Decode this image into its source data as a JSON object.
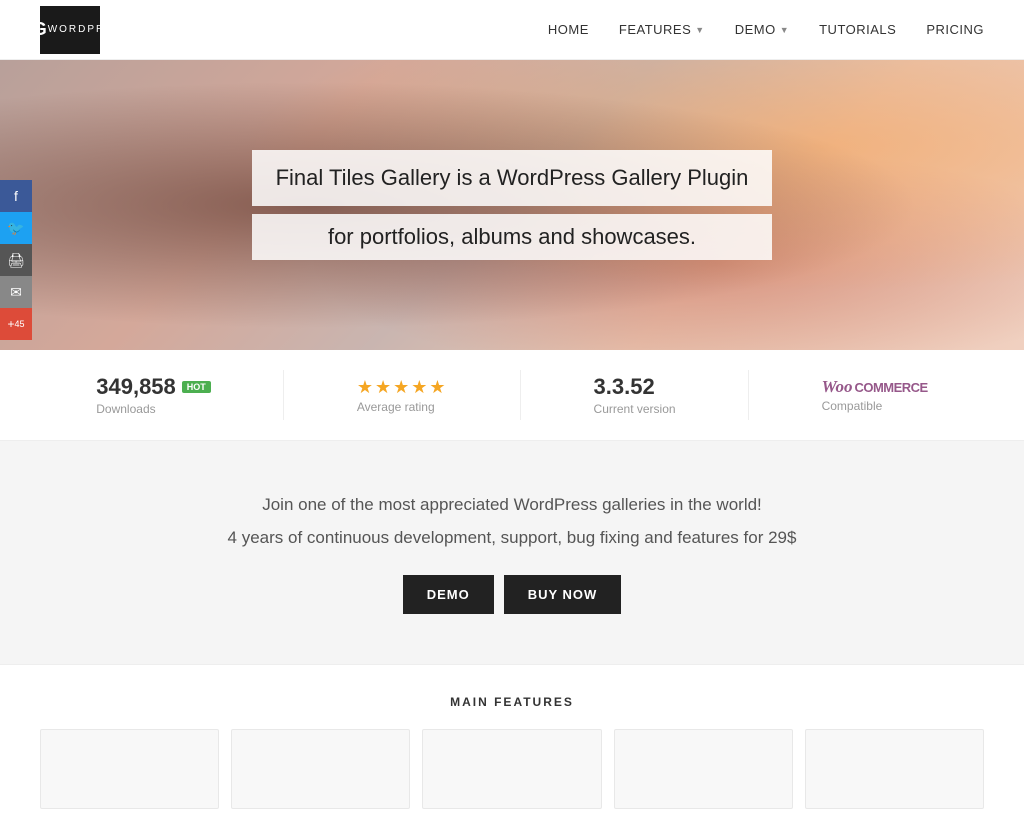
{
  "logo": {
    "main": "FTG",
    "sub": "WORDPRESS"
  },
  "nav": {
    "links": [
      {
        "label": "HOME",
        "hasDropdown": false
      },
      {
        "label": "FEATURES",
        "hasDropdown": true
      },
      {
        "label": "DEMO",
        "hasDropdown": true
      },
      {
        "label": "TUTORIALS",
        "hasDropdown": false
      },
      {
        "label": "PRICING",
        "hasDropdown": false
      }
    ]
  },
  "social": [
    {
      "name": "facebook",
      "icon": "f",
      "class": "facebook"
    },
    {
      "name": "twitter",
      "icon": "t",
      "class": "twitter"
    },
    {
      "name": "print",
      "icon": "⎙",
      "class": "print"
    },
    {
      "name": "email",
      "icon": "✉",
      "class": "email"
    },
    {
      "name": "plus",
      "icon": "+",
      "count": "45",
      "class": "plus"
    }
  ],
  "hero": {
    "line1": "Final Tiles Gallery is a WordPress Gallery Plugin",
    "line2": "for portfolios, albums and showcases."
  },
  "stats": [
    {
      "id": "downloads",
      "value": "349,858",
      "badge": "hot",
      "label": "Downloads"
    },
    {
      "id": "rating",
      "stars": "★★★★★",
      "label": "Average rating"
    },
    {
      "id": "version",
      "value": "3.3.52",
      "label": "Current version"
    },
    {
      "id": "compatible",
      "woo": true,
      "label": "Compatible"
    }
  ],
  "cta": {
    "line1": "Join one of the most appreciated WordPress galleries in the world!",
    "line2": "4 years of continuous development, support, bug fixing and features for 29$",
    "btn_demo": "DEMO",
    "btn_buy": "BUY NOW"
  },
  "features": {
    "title": "MAIN FEATURES"
  }
}
